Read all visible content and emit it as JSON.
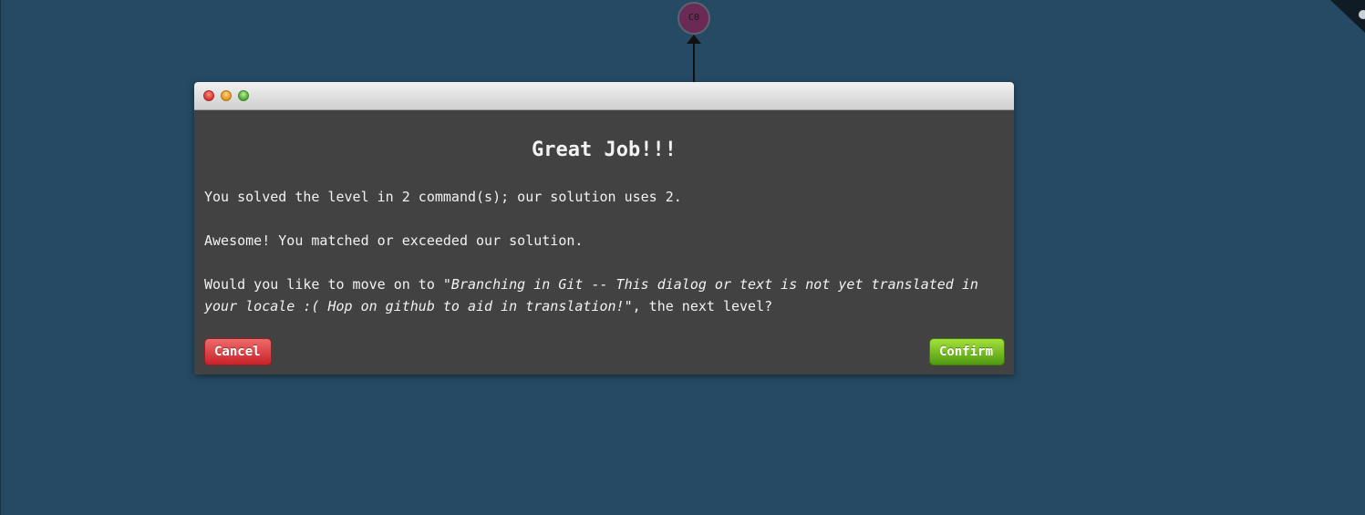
{
  "tree": {
    "commit_label": "C0"
  },
  "dialog": {
    "heading": "Great Job!!!",
    "line1": "You solved the level in 2 command(s); our solution uses 2.",
    "line2": "Awesome! You matched or exceeded our solution.",
    "line3_prefix": "Would you like to move on to ",
    "line3_level": "\"Branching in Git -- This dialog or text is not yet translated in your locale :( Hop on github to aid in translation!\"",
    "line3_suffix": ", the next level?",
    "cancel_label": "Cancel",
    "confirm_label": "Confirm"
  },
  "colors": {
    "background": "#264a64",
    "dialog_body": "#424242",
    "commit_fill": "#6b2a55",
    "cancel": "#d9342b",
    "confirm": "#6fbe1e"
  },
  "icons": {
    "close": "close-icon",
    "minimize": "minimize-icon",
    "maximize": "maximize-icon"
  }
}
